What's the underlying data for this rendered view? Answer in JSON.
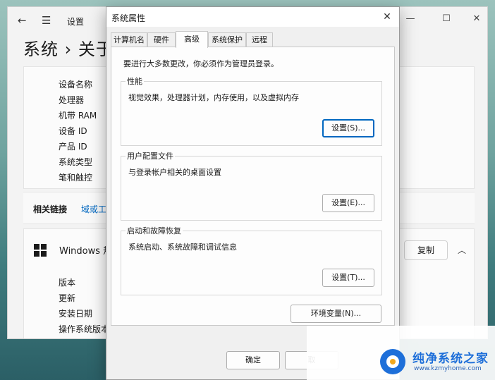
{
  "settings": {
    "title": "设置",
    "heading": "系统  ›  关于",
    "specs": [
      "设备名称",
      "处理器",
      "机带 RAM",
      "设备 ID",
      "产品 ID",
      "系统类型",
      "笔和触控"
    ],
    "related_label": "相关链接",
    "related_link": "域或工",
    "windows_section": "Windows 规",
    "copy_button": "复制",
    "windows_rows": [
      "版本",
      "更新",
      "安装日期",
      "操作系统版本"
    ],
    "controls": {
      "minimize": "—",
      "maximize": "☐",
      "close": "✕",
      "back": "←",
      "menu": "☰",
      "chevron": "︿"
    }
  },
  "dialog": {
    "title": "系统属性",
    "close": "✕",
    "tabs": [
      "计算机名",
      "硬件",
      "高级",
      "系统保护",
      "远程"
    ],
    "active_tab": "高级",
    "notice": "要进行大多数更改，你必须作为管理员登录。",
    "groups": [
      {
        "title": "性能",
        "desc": "视觉效果，处理器计划，内存使用，以及虚拟内存",
        "button": "设置(S)..."
      },
      {
        "title": "用户配置文件",
        "desc": "与登录帐户相关的桌面设置",
        "button": "设置(E)..."
      },
      {
        "title": "启动和故障恢复",
        "desc": "系统启动、系统故障和调试信息",
        "button": "设置(T)..."
      }
    ],
    "env_button": "环境变量(N)...",
    "ok": "确定",
    "cancel": "取"
  },
  "watermark": {
    "title": "纯净系统之家",
    "url": "www.kzmyhome.com"
  }
}
